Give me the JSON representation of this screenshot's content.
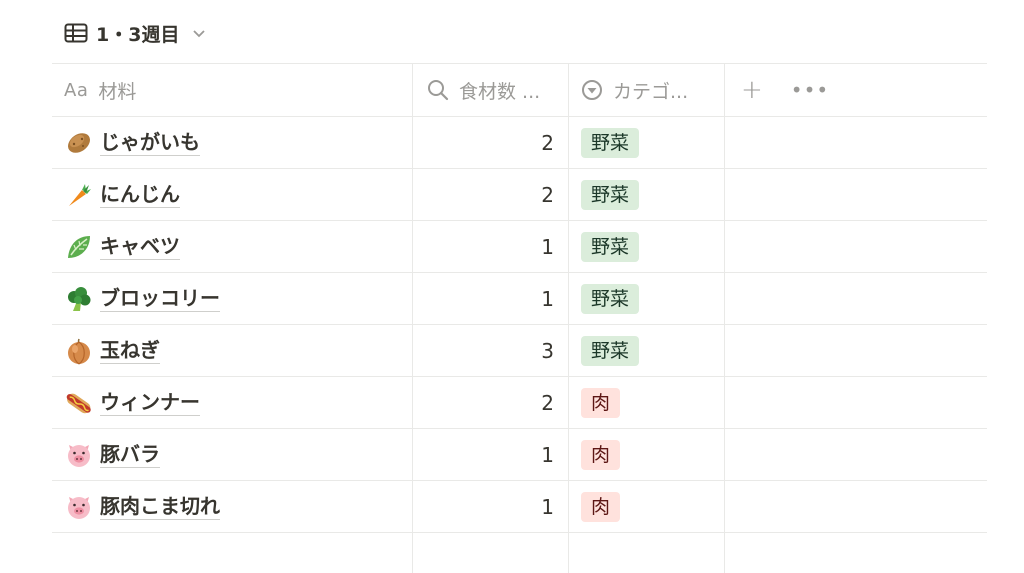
{
  "view": {
    "title": "1・3週目"
  },
  "columns": {
    "name": {
      "prefix": "Aa",
      "label": "材料"
    },
    "count": {
      "label": "食材数 ..."
    },
    "category": {
      "label": "カテゴ..."
    },
    "add": "+",
    "more": "•••"
  },
  "rows": [
    {
      "emoji": "potato-icon",
      "name": "じゃがいも",
      "count": "2",
      "category": "野菜",
      "type": "veg"
    },
    {
      "emoji": "carrot-icon",
      "name": "にんじん",
      "count": "2",
      "category": "野菜",
      "type": "veg"
    },
    {
      "emoji": "cabbage-icon",
      "name": "キャベツ",
      "count": "1",
      "category": "野菜",
      "type": "veg"
    },
    {
      "emoji": "broccoli-icon",
      "name": "ブロッコリー",
      "count": "1",
      "category": "野菜",
      "type": "veg"
    },
    {
      "emoji": "onion-icon",
      "name": "玉ねぎ",
      "count": "3",
      "category": "野菜",
      "type": "veg"
    },
    {
      "emoji": "hotdog-icon",
      "name": "ウィンナー",
      "count": "2",
      "category": "肉",
      "type": "meat"
    },
    {
      "emoji": "pig-icon",
      "name": "豚バラ",
      "count": "1",
      "category": "肉",
      "type": "meat"
    },
    {
      "emoji": "pig-icon",
      "name": "豚肉こま切れ",
      "count": "1",
      "category": "肉",
      "type": "meat"
    }
  ]
}
